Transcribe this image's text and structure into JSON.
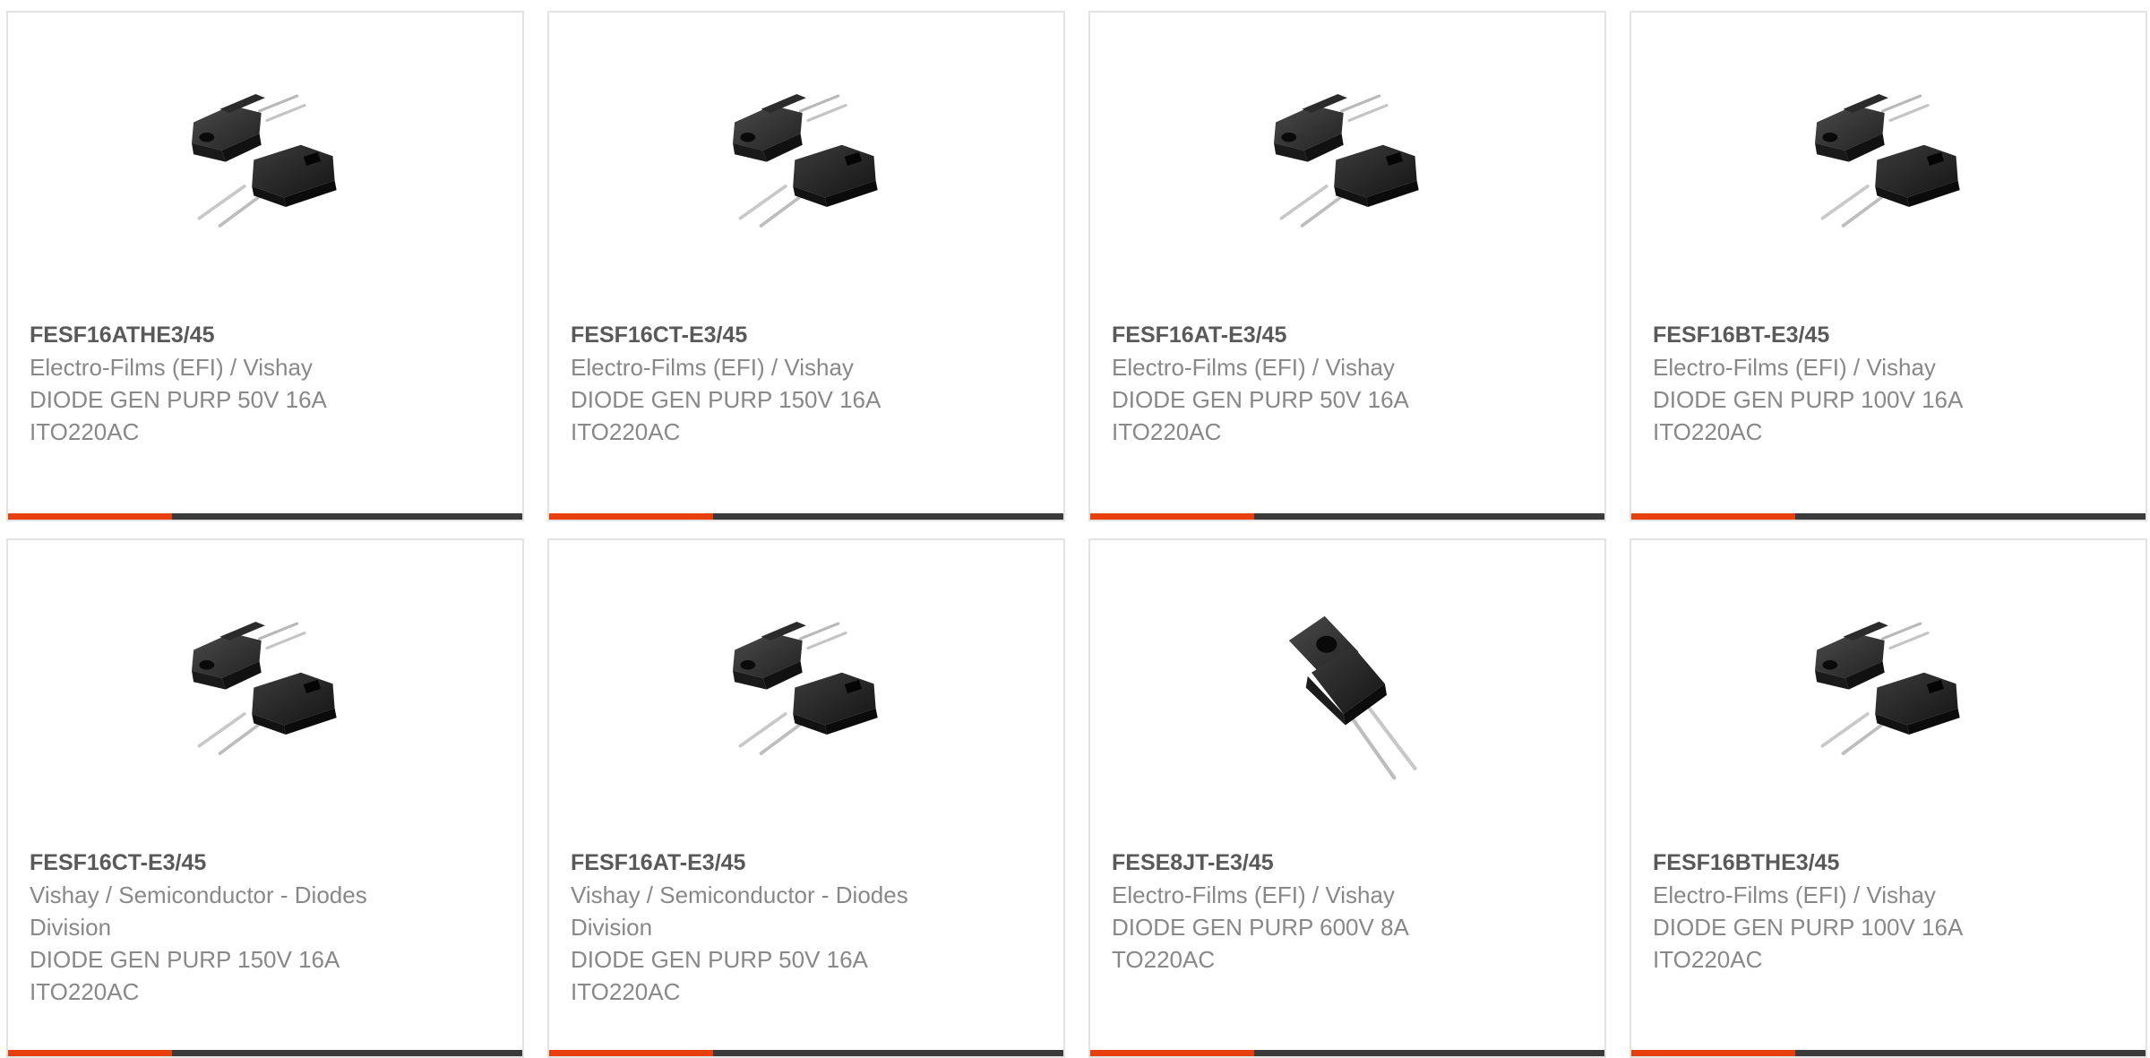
{
  "colors": {
    "accent": "#e8400c",
    "bar_dark": "#3a3a3a",
    "title_text": "#595959",
    "body_text": "#888888",
    "card_border": "#e3e3e3"
  },
  "products": [
    {
      "part_number": "FESF16ATHE3/45",
      "manufacturer_lines": [
        "Electro-Films (EFI) / Vishay"
      ],
      "description_lines": [
        "DIODE GEN PURP 50V 16A",
        "ITO220AC"
      ],
      "image_icon": "diode-pair-ito220ac-icon"
    },
    {
      "part_number": "FESF16CT-E3/45",
      "manufacturer_lines": [
        "Electro-Films (EFI) / Vishay"
      ],
      "description_lines": [
        "DIODE GEN PURP 150V 16A",
        "ITO220AC"
      ],
      "image_icon": "diode-pair-ito220ac-icon"
    },
    {
      "part_number": "FESF16AT-E3/45",
      "manufacturer_lines": [
        "Electro-Films (EFI) / Vishay"
      ],
      "description_lines": [
        "DIODE GEN PURP 50V 16A",
        "ITO220AC"
      ],
      "image_icon": "diode-pair-ito220ac-icon"
    },
    {
      "part_number": "FESF16BT-E3/45",
      "manufacturer_lines": [
        "Electro-Films (EFI) / Vishay"
      ],
      "description_lines": [
        "DIODE GEN PURP 100V 16A",
        "ITO220AC"
      ],
      "image_icon": "diode-pair-ito220ac-icon"
    },
    {
      "part_number": "FESF16CT-E3/45",
      "manufacturer_lines": [
        "Vishay / Semiconductor - Diodes",
        "Division"
      ],
      "description_lines": [
        "DIODE GEN PURP 150V 16A",
        "ITO220AC"
      ],
      "image_icon": "diode-pair-ito220ac-icon"
    },
    {
      "part_number": "FESF16AT-E3/45",
      "manufacturer_lines": [
        "Vishay / Semiconductor - Diodes",
        "Division"
      ],
      "description_lines": [
        "DIODE GEN PURP 50V 16A",
        "ITO220AC"
      ],
      "image_icon": "diode-pair-ito220ac-icon"
    },
    {
      "part_number": "FESE8JT-E3/45",
      "manufacturer_lines": [
        "Electro-Films (EFI) / Vishay"
      ],
      "description_lines": [
        "DIODE GEN PURP 600V 8A",
        "TO220AC"
      ],
      "image_icon": "diode-single-to220ac-icon"
    },
    {
      "part_number": "FESF16BTHE3/45",
      "manufacturer_lines": [
        "Electro-Films (EFI) / Vishay"
      ],
      "description_lines": [
        "DIODE GEN PURP 100V 16A",
        "ITO220AC"
      ],
      "image_icon": "diode-pair-ito220ac-icon"
    }
  ]
}
